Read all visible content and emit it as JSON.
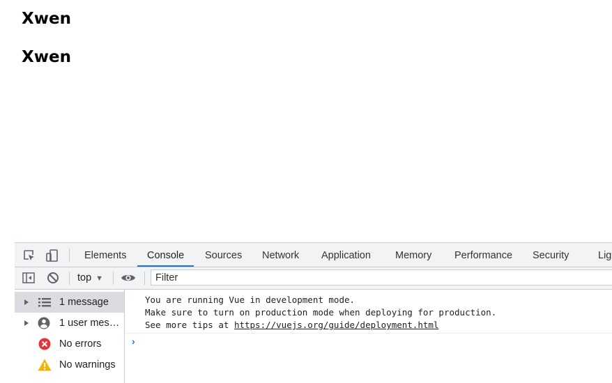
{
  "page": {
    "headings": [
      "Xwen",
      "Xwen"
    ]
  },
  "devtools": {
    "tabs": [
      {
        "label": "Elements"
      },
      {
        "label": "Console",
        "selected": true
      },
      {
        "label": "Sources"
      },
      {
        "label": "Network"
      },
      {
        "label": "Application"
      },
      {
        "label": "Memory"
      },
      {
        "label": "Performance"
      },
      {
        "label": "Security"
      },
      {
        "label": "Lig"
      }
    ],
    "toolbar": {
      "context": "top",
      "caret": "▼",
      "filter_placeholder": "Filter"
    },
    "sidebar": {
      "items": [
        {
          "label": "1 message",
          "icon": "list-icon"
        },
        {
          "label": "1 user mess…",
          "icon": "user-icon"
        },
        {
          "label": "No errors",
          "icon": "error-icon"
        },
        {
          "label": "No warnings",
          "icon": "warning-icon"
        }
      ]
    },
    "console": {
      "message_line1": "You are running Vue in development mode.",
      "message_line2": "Make sure to turn on production mode when deploying for production.",
      "message_line3_prefix": "See more tips at ",
      "message_link": "https://vuejs.org/guide/deployment.html",
      "prompt": "›"
    },
    "colors": {
      "accent": "#1a73e8",
      "error": "#d93025",
      "warning": "#f9ab00"
    }
  }
}
